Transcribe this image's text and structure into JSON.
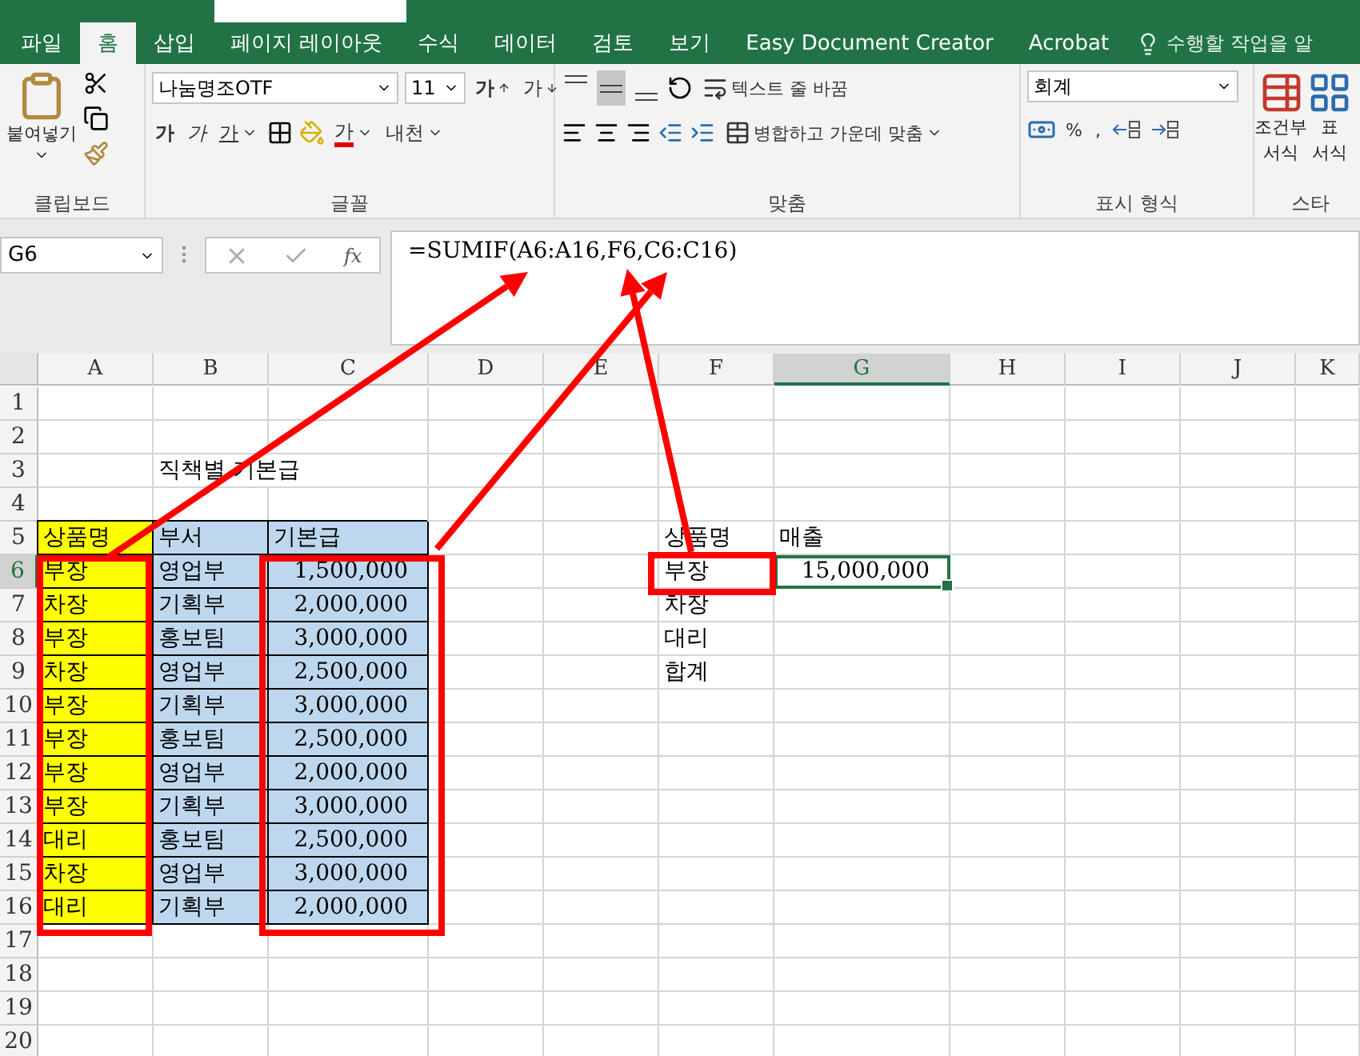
{
  "ribbon_tabs": [
    {
      "label": "파일",
      "selected": false
    },
    {
      "label": "홈",
      "selected": true
    },
    {
      "label": "삽입",
      "selected": false
    },
    {
      "label": "페이지 레이아웃",
      "selected": false
    },
    {
      "label": "수식",
      "selected": false
    },
    {
      "label": "데이터",
      "selected": false
    },
    {
      "label": "검토",
      "selected": false
    },
    {
      "label": "보기",
      "selected": false
    },
    {
      "label": "Easy Document Creator",
      "selected": false
    },
    {
      "label": "Acrobat",
      "selected": false
    }
  ],
  "tell_me": "수행할 작업을 알",
  "clipboard": {
    "paste": "붙여넣기",
    "group_label": "클립보드"
  },
  "font": {
    "name": "나눔명조OTF",
    "pt": "11",
    "grow": "가",
    "shrink": "가",
    "bold": "가",
    "italic": "가",
    "underline": "가",
    "font_color": "가",
    "phonetic": "내천",
    "group_label": "글꼴"
  },
  "alignment": {
    "vertical": [
      {
        "selected": false
      },
      {
        "selected": true
      },
      {
        "selected": false
      }
    ],
    "wrap": "텍스트 줄 바꿈",
    "merge": "병합하고 가운데 맞춤",
    "group_label": "맞춤"
  },
  "number": {
    "format": "회계",
    "percent": "%",
    "comma": ",",
    "group_label": "표시 형식"
  },
  "styles": {
    "conditional": [
      "조건부",
      "서식"
    ],
    "table": [
      "표",
      "서식"
    ],
    "group_label": "스타"
  },
  "name_box": "G6",
  "fx": "fx",
  "formula": "=SUMIF(A6:A16,F6,C6:C16)",
  "columns": [
    {
      "label": "A",
      "selected": false
    },
    {
      "label": "B",
      "selected": false
    },
    {
      "label": "C",
      "selected": false
    },
    {
      "label": "D",
      "selected": false
    },
    {
      "label": "E",
      "selected": false
    },
    {
      "label": "F",
      "selected": false
    },
    {
      "label": "G",
      "selected": true
    },
    {
      "label": "H",
      "selected": false
    },
    {
      "label": "I",
      "selected": false
    },
    {
      "label": "J",
      "selected": false
    },
    {
      "label": "K",
      "selected": false
    }
  ],
  "rows": [
    {
      "label": "1",
      "selected": false
    },
    {
      "label": "2",
      "selected": false
    },
    {
      "label": "3",
      "selected": false,
      "B": {
        "text": "직책별 기본급",
        "kind": "overflow",
        "selected": false
      }
    },
    {
      "label": "4",
      "selected": false
    },
    {
      "label": "5",
      "selected": false,
      "A": {
        "text": "상품명",
        "kind": "text",
        "color": "#ffff00",
        "selected": false
      },
      "B": {
        "text": "부서",
        "kind": "text",
        "color": "#bdd7ee",
        "selected": false
      },
      "C": {
        "text": "기본급",
        "kind": "text",
        "color": "#bdd7ee",
        "selected": false
      },
      "F": {
        "text": "상품명",
        "kind": "text",
        "selected": false
      },
      "G": {
        "text": "매출",
        "kind": "text",
        "selected": false
      }
    },
    {
      "label": "6",
      "selected": true,
      "A": {
        "text": "부장",
        "kind": "text",
        "color": "#ffff00",
        "selected": false
      },
      "B": {
        "text": "영업부",
        "kind": "text",
        "color": "#bdd7ee",
        "selected": false
      },
      "C": {
        "text": "1,500,000",
        "kind": "number",
        "color": "#bdd7ee",
        "selected": false
      },
      "F": {
        "text": "부장",
        "kind": "text",
        "selected": false
      },
      "G": {
        "text": "15,000,000",
        "kind": "number",
        "selected": true
      }
    },
    {
      "label": "7",
      "selected": false,
      "A": {
        "text": "차장",
        "kind": "text",
        "color": "#ffff00",
        "selected": false
      },
      "B": {
        "text": "기획부",
        "kind": "text",
        "color": "#bdd7ee",
        "selected": false
      },
      "C": {
        "text": "2,000,000",
        "kind": "number",
        "color": "#bdd7ee",
        "selected": false
      },
      "F": {
        "text": "차장",
        "kind": "text",
        "selected": false
      }
    },
    {
      "label": "8",
      "selected": false,
      "A": {
        "text": "부장",
        "kind": "text",
        "color": "#ffff00",
        "selected": false
      },
      "B": {
        "text": "홍보팀",
        "kind": "text",
        "color": "#bdd7ee",
        "selected": false
      },
      "C": {
        "text": "3,000,000",
        "kind": "number",
        "color": "#bdd7ee",
        "selected": false
      },
      "F": {
        "text": "대리",
        "kind": "text",
        "selected": false
      }
    },
    {
      "label": "9",
      "selected": false,
      "A": {
        "text": "차장",
        "kind": "text",
        "color": "#ffff00",
        "selected": false
      },
      "B": {
        "text": "영업부",
        "kind": "text",
        "color": "#bdd7ee",
        "selected": false
      },
      "C": {
        "text": "2,500,000",
        "kind": "number",
        "color": "#bdd7ee",
        "selected": false
      },
      "F": {
        "text": "합계",
        "kind": "text",
        "selected": false
      }
    },
    {
      "label": "10",
      "selected": false,
      "A": {
        "text": "부장",
        "kind": "text",
        "color": "#ffff00",
        "selected": false
      },
      "B": {
        "text": "기획부",
        "kind": "text",
        "color": "#bdd7ee",
        "selected": false
      },
      "C": {
        "text": "3,000,000",
        "kind": "number",
        "color": "#bdd7ee",
        "selected": false
      }
    },
    {
      "label": "11",
      "selected": false,
      "A": {
        "text": "부장",
        "kind": "text",
        "color": "#ffff00",
        "selected": false
      },
      "B": {
        "text": "홍보팀",
        "kind": "text",
        "color": "#bdd7ee",
        "selected": false
      },
      "C": {
        "text": "2,500,000",
        "kind": "number",
        "color": "#bdd7ee",
        "selected": false
      }
    },
    {
      "label": "12",
      "selected": false,
      "A": {
        "text": "부장",
        "kind": "text",
        "color": "#ffff00",
        "selected": false
      },
      "B": {
        "text": "영업부",
        "kind": "text",
        "color": "#bdd7ee",
        "selected": false
      },
      "C": {
        "text": "2,000,000",
        "kind": "number",
        "color": "#bdd7ee",
        "selected": false
      }
    },
    {
      "label": "13",
      "selected": false,
      "A": {
        "text": "부장",
        "kind": "text",
        "color": "#ffff00",
        "selected": false
      },
      "B": {
        "text": "기획부",
        "kind": "text",
        "color": "#bdd7ee",
        "selected": false
      },
      "C": {
        "text": "3,000,000",
        "kind": "number",
        "color": "#bdd7ee",
        "selected": false
      }
    },
    {
      "label": "14",
      "selected": false,
      "A": {
        "text": "대리",
        "kind": "text",
        "color": "#ffff00",
        "selected": false
      },
      "B": {
        "text": "홍보팀",
        "kind": "text",
        "color": "#bdd7ee",
        "selected": false
      },
      "C": {
        "text": "2,500,000",
        "kind": "number",
        "color": "#bdd7ee",
        "selected": false
      }
    },
    {
      "label": "15",
      "selected": false,
      "A": {
        "text": "차장",
        "kind": "text",
        "color": "#ffff00",
        "selected": false
      },
      "B": {
        "text": "영업부",
        "kind": "text",
        "color": "#bdd7ee",
        "selected": false
      },
      "C": {
        "text": "3,000,000",
        "kind": "number",
        "color": "#bdd7ee",
        "selected": false
      }
    },
    {
      "label": "16",
      "selected": false,
      "A": {
        "text": "대리",
        "kind": "text",
        "color": "#ffff00",
        "selected": false
      },
      "B": {
        "text": "기획부",
        "kind": "text",
        "color": "#bdd7ee",
        "selected": false
      },
      "C": {
        "text": "2,000,000",
        "kind": "number",
        "color": "#bdd7ee",
        "selected": false
      }
    },
    {
      "label": "17",
      "selected": false
    },
    {
      "label": "18",
      "selected": false
    },
    {
      "label": "19",
      "selected": false
    },
    {
      "label": "20",
      "selected": false
    }
  ],
  "annotations": [
    {
      "kind": "box"
    },
    {
      "kind": "box"
    },
    {
      "kind": "box"
    },
    {
      "kind": "arrow"
    },
    {
      "kind": "arrow"
    },
    {
      "kind": "arrow"
    }
  ]
}
